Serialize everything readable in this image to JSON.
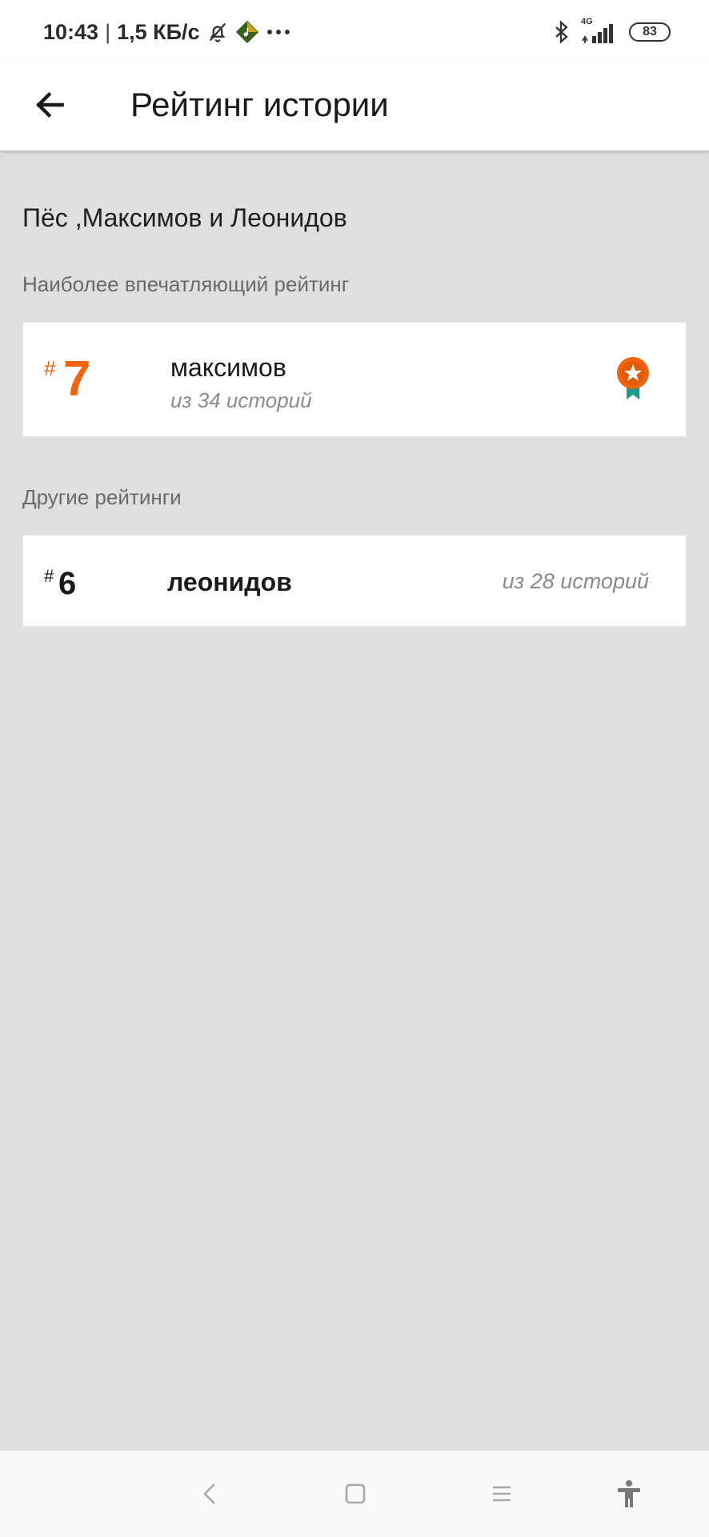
{
  "status_bar": {
    "time": "10:43",
    "separator": "|",
    "speed": "1,5 КБ/с",
    "network": "4G",
    "battery": "83",
    "icons": [
      "bell-off-icon",
      "music-app-icon",
      "more-dots-icon",
      "bluetooth-icon",
      "signal-icon",
      "battery-icon"
    ]
  },
  "app_bar": {
    "title": "Рейтинг истории",
    "back_icon": "arrow-left-icon"
  },
  "story": {
    "title": "Пёс ,Максимов и Леонидов"
  },
  "featured_section": {
    "label": "Наиболее впечатляющий рейтинг",
    "item": {
      "hash": "#",
      "rank": "7",
      "name": "максимов",
      "subtitle": "из 34 историй",
      "badge_icon": "award-badge-icon"
    }
  },
  "other_section": {
    "label": "Другие рейтинги",
    "items": [
      {
        "hash": "#",
        "rank": "6",
        "name": "леонидов",
        "subtitle": "из 28 историй"
      }
    ]
  },
  "nav_bar": {
    "icons": [
      "back-nav-icon",
      "home-nav-icon",
      "recents-nav-icon",
      "accessibility-icon"
    ]
  },
  "colors": {
    "accent": "#f0640e",
    "badge_ribbon": "#1e9a8a",
    "background": "#dfdee1"
  }
}
